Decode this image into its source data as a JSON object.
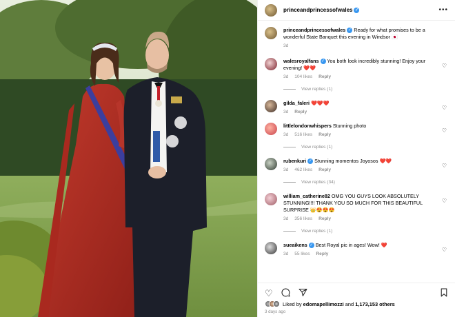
{
  "post": {
    "author": "princeandprincessofwales",
    "caption": "Ready for what promises to be a wonderful State Banquet this evening in Windsor",
    "caption_flag": "🇯🇵",
    "caption_age": "3d",
    "likes_by": "edomapellimozzi",
    "likes_others": "1,173,153 others",
    "likes_prefix": "Liked by ",
    "likes_mid": " and ",
    "date": "3 days ago"
  },
  "comments": [
    {
      "user": "walesroyalfans",
      "text": "You both look incredibly stunning! Enjoy your evening!",
      "emoji": "❤️❤️",
      "age": "3d",
      "likes": "104 likes",
      "reply": "Reply",
      "views": "View replies (1)",
      "verified": true
    },
    {
      "user": "gilda_faleri",
      "text": "",
      "emoji": "❤️❤️❤️",
      "age": "3d",
      "likes": "",
      "reply": "Reply",
      "views": "",
      "verified": false
    },
    {
      "user": "littlelondonwhispers",
      "text": "Stunning photo",
      "emoji": "",
      "age": "3d",
      "likes": "516 likes",
      "reply": "Reply",
      "views": "View replies (1)",
      "verified": false
    },
    {
      "user": "rubenkuri",
      "text": "Stunning momentos Joyosos",
      "emoji": "❤️❤️",
      "age": "3d",
      "likes": "462 likes",
      "reply": "Reply",
      "views": "View replies (34)",
      "verified": true
    },
    {
      "user": "william_catherine82",
      "text": "OMG YOU GUYS LOOK ABSOLUTELY STUNNING!!!! THANK YOU SO MUCH FOR THIS BEAUTIFUL SURPRISE",
      "emoji": "👑😍😍😍",
      "age": "3d",
      "likes": "356 likes",
      "reply": "Reply",
      "views": "View replies (1)",
      "verified": false
    },
    {
      "user": "sueaikens",
      "text": "Best Royal pic in ages! Wow!",
      "emoji": "❤️",
      "age": "3d",
      "likes": "55 likes",
      "reply": "Reply",
      "views": "",
      "verified": true
    }
  ],
  "icons": {
    "more": "•••",
    "like": "heart-icon",
    "comment": "comment-icon",
    "share": "share-icon",
    "save": "bookmark-icon"
  }
}
